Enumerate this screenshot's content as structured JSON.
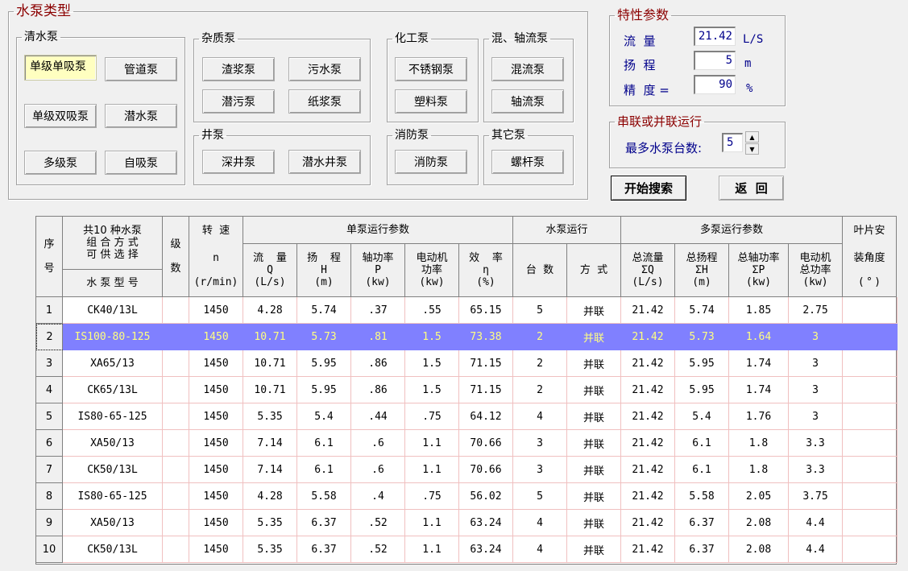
{
  "pump_type": {
    "title": "水泵类型",
    "groups": {
      "clear_water": {
        "label": "清水泵",
        "buttons": [
          "单级单吸泵",
          "管道泵",
          "单级双吸泵",
          "潜水泵",
          "多级泵",
          "自吸泵"
        ]
      },
      "impurity": {
        "label": "杂质泵",
        "buttons": [
          "渣浆泵",
          "污水泵",
          "潜污泵",
          "纸浆泵"
        ]
      },
      "well": {
        "label": "井泵",
        "buttons": [
          "深井泵",
          "潜水井泵"
        ]
      },
      "chemical": {
        "label": "化工泵",
        "buttons": [
          "不锈钢泵",
          "塑料泵"
        ]
      },
      "mixed_axial": {
        "label": "混、轴流泵",
        "buttons": [
          "混流泵",
          "轴流泵"
        ]
      },
      "fire": {
        "label": "消防泵",
        "buttons": [
          "消防泵"
        ]
      },
      "other": {
        "label": "其它泵",
        "buttons": [
          "螺杆泵"
        ]
      }
    },
    "selected": "单级单吸泵"
  },
  "characteristics": {
    "title": "特性参数",
    "flow_label": "流  量",
    "flow_value": "21.42",
    "flow_unit": "L/S",
    "head_label": "扬  程",
    "head_value": "5",
    "head_unit": "m",
    "precision_label": "精  度 =",
    "precision_value": "90",
    "precision_unit": "%"
  },
  "series_parallel": {
    "title": "串联或并联运行",
    "max_label": "最多水泵台数:",
    "max_value": "5"
  },
  "actions": {
    "search": "开始搜索",
    "back": "返  回"
  },
  "grid": {
    "headers": {
      "seq": "序\n\n号",
      "combo_top": "共10 种水泵\n组 合 方 式\n可 供 选 择",
      "model": "水 泵 型 号",
      "stage": "级\n\n数",
      "speed_top": "转  速",
      "speed_bottom": "n\n\n(r/min)",
      "single_group": "单泵运行参数",
      "flow": "流  量\nQ\n(L/s)",
      "head": "扬  程\nH\n(m)",
      "shaft_power": "轴功率\nP\n(kw)",
      "motor_power": "电动机\n功率\n(kw)",
      "efficiency": "效  率\nη\n(%)",
      "run_group": "水泵运行",
      "count": "台  数",
      "mode": "方  式",
      "multi_group": "多泵运行参数",
      "total_flow": "总流量\nΣQ\n(L/s)",
      "total_head": "总扬程\nΣH\n(m)",
      "total_shaft": "总轴功率\nΣP\n(kw)",
      "total_motor": "电动机\n总功率\n(kw)",
      "blade_top": "叶片安",
      "blade_bottom": "装角度\n\n( ° )"
    },
    "selected_row": 1,
    "rows": [
      [
        "1",
        "CK40/13L",
        "",
        "1450",
        "4.28",
        "5.74",
        ".37",
        ".55",
        "65.15",
        "5",
        "并联",
        "21.42",
        "5.74",
        "1.85",
        "2.75",
        ""
      ],
      [
        "2",
        "IS100-80-125",
        "",
        "1450",
        "10.71",
        "5.73",
        ".81",
        "1.5",
        "73.38",
        "2",
        "并联",
        "21.42",
        "5.73",
        "1.64",
        "3",
        ""
      ],
      [
        "3",
        "XA65/13",
        "",
        "1450",
        "10.71",
        "5.95",
        ".86",
        "1.5",
        "71.15",
        "2",
        "并联",
        "21.42",
        "5.95",
        "1.74",
        "3",
        ""
      ],
      [
        "4",
        "CK65/13L",
        "",
        "1450",
        "10.71",
        "5.95",
        ".86",
        "1.5",
        "71.15",
        "2",
        "并联",
        "21.42",
        "5.95",
        "1.74",
        "3",
        ""
      ],
      [
        "5",
        "IS80-65-125",
        "",
        "1450",
        "5.35",
        "5.4",
        ".44",
        ".75",
        "64.12",
        "4",
        "并联",
        "21.42",
        "5.4",
        "1.76",
        "3",
        ""
      ],
      [
        "6",
        "XA50/13",
        "",
        "1450",
        "7.14",
        "6.1",
        ".6",
        "1.1",
        "70.66",
        "3",
        "并联",
        "21.42",
        "6.1",
        "1.8",
        "3.3",
        ""
      ],
      [
        "7",
        "CK50/13L",
        "",
        "1450",
        "7.14",
        "6.1",
        ".6",
        "1.1",
        "70.66",
        "3",
        "并联",
        "21.42",
        "6.1",
        "1.8",
        "3.3",
        ""
      ],
      [
        "8",
        "IS80-65-125",
        "",
        "1450",
        "4.28",
        "5.58",
        ".4",
        ".75",
        "56.02",
        "5",
        "并联",
        "21.42",
        "5.58",
        "2.05",
        "3.75",
        ""
      ],
      [
        "9",
        "XA50/13",
        "",
        "1450",
        "5.35",
        "6.37",
        ".52",
        "1.1",
        "63.24",
        "4",
        "并联",
        "21.42",
        "6.37",
        "2.08",
        "4.4",
        ""
      ],
      [
        "10",
        "CK50/13L",
        "",
        "1450",
        "5.35",
        "6.37",
        ".52",
        "1.1",
        "63.24",
        "4",
        "并联",
        "21.42",
        "6.37",
        "2.08",
        "4.4",
        ""
      ]
    ]
  }
}
